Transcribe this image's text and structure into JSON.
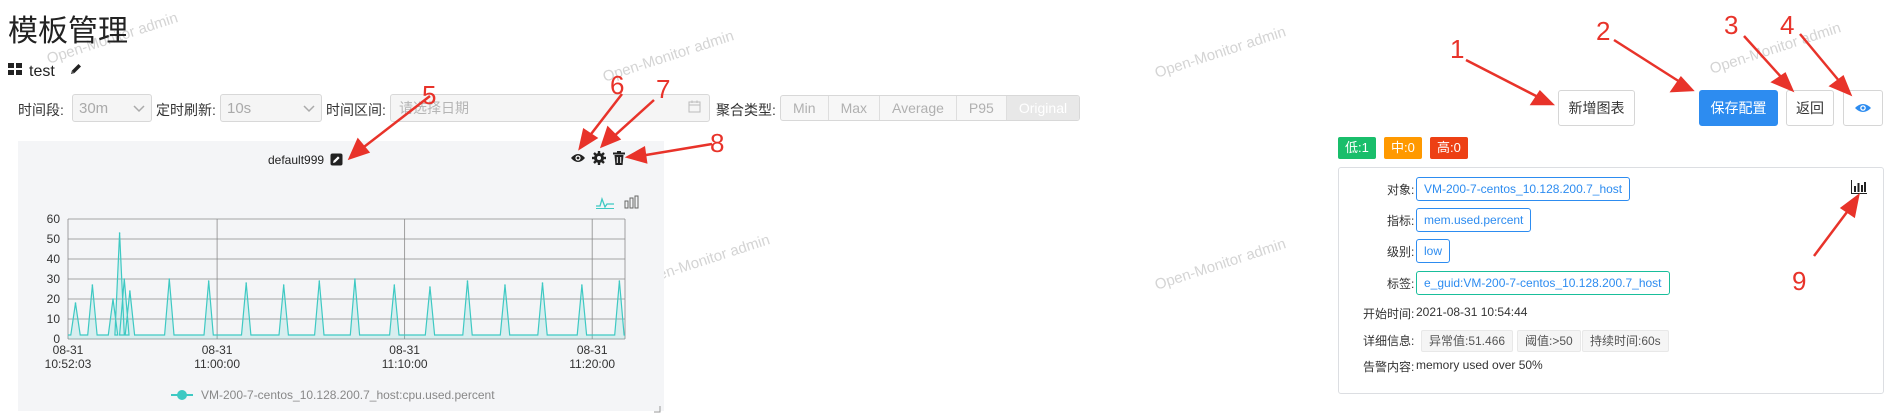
{
  "page": {
    "title": "模板管理",
    "watermark": "Open-Monitor admin"
  },
  "template": {
    "name": "test"
  },
  "filters": {
    "period_label": "时间段:",
    "period_value": "30m",
    "refresh_label": "定时刷新:",
    "refresh_value": "10s",
    "range_label": "时间区间:",
    "range_placeholder": "请选择日期",
    "agg_label": "聚合类型:",
    "agg_options": [
      "Min",
      "Max",
      "Average",
      "P95",
      "Original"
    ],
    "agg_selected": "Original"
  },
  "chart_card": {
    "title": "default999",
    "legend": "VM-200-7-centos_10.128.200.7_host:cpu.used.percent",
    "series_color": "#3ec9c3"
  },
  "chart_data": {
    "type": "line",
    "title": "",
    "xlabel": "",
    "ylabel": "",
    "ylim": [
      0,
      60
    ],
    "yticks": [
      0,
      10,
      20,
      30,
      40,
      50,
      60
    ],
    "xticks": [
      {
        "date": "08-31",
        "time": "10:52:03"
      },
      {
        "date": "08-31",
        "time": "11:00:00"
      },
      {
        "date": "08-31",
        "time": "11:10:00"
      },
      {
        "date": "08-31",
        "time": "11:20:00"
      }
    ],
    "xrange_minutes": [
      0,
      29.7
    ],
    "grid": true,
    "legend_position": "bottom",
    "series": [
      {
        "name": "VM-200-7-centos_10.128.200.7_host:cpu.used.percent",
        "baseline": 2,
        "spikes": [
          {
            "t": 0.4,
            "v": 18
          },
          {
            "t": 1.3,
            "v": 27
          },
          {
            "t": 2.4,
            "v": 20
          },
          {
            "t": 2.75,
            "v": 53
          },
          {
            "t": 3.0,
            "v": 30
          },
          {
            "t": 3.3,
            "v": 24
          },
          {
            "t": 5.4,
            "v": 30
          },
          {
            "t": 7.5,
            "v": 29
          },
          {
            "t": 9.5,
            "v": 28
          },
          {
            "t": 11.5,
            "v": 27
          },
          {
            "t": 13.4,
            "v": 29
          },
          {
            "t": 15.3,
            "v": 30
          },
          {
            "t": 17.4,
            "v": 27
          },
          {
            "t": 19.3,
            "v": 26
          },
          {
            "t": 21.3,
            "v": 29
          },
          {
            "t": 23.3,
            "v": 27
          },
          {
            "t": 25.3,
            "v": 28
          },
          {
            "t": 27.4,
            "v": 27
          },
          {
            "t": 29.4,
            "v": 29
          }
        ]
      }
    ]
  },
  "toolbar": {
    "add_chart": "新增图表",
    "save_config": "保存配置",
    "back": "返回"
  },
  "counts": {
    "low": "低:1",
    "mid": "中:0",
    "high": "高:0"
  },
  "alarm": {
    "object_label": "对象:",
    "object_value": "VM-200-7-centos_10.128.200.7_host",
    "metric_label": "指标:",
    "metric_value": "mem.used.percent",
    "level_label": "级别:",
    "level_value": "low",
    "tag_label": "标签:",
    "tag_value": "e_guid:VM-200-7-centos_10.128.200.7_host",
    "start_label": "开始时间:",
    "start_value": "2021-08-31 10:54:44",
    "detail_label": "详细信息:",
    "detail_tags": [
      "异常值:51.466",
      "阈值:>50",
      "持续时间:60s"
    ],
    "content_label": "告警内容:",
    "content_value": "memory used over 50%"
  },
  "annotations": [
    "1",
    "2",
    "3",
    "4",
    "5",
    "6",
    "7",
    "8",
    "9"
  ],
  "colors": {
    "primary": "#2d8cf0",
    "low": "#19be6b",
    "mid": "#ff9900",
    "high": "#ed4014",
    "annotation": "#e8332a"
  }
}
